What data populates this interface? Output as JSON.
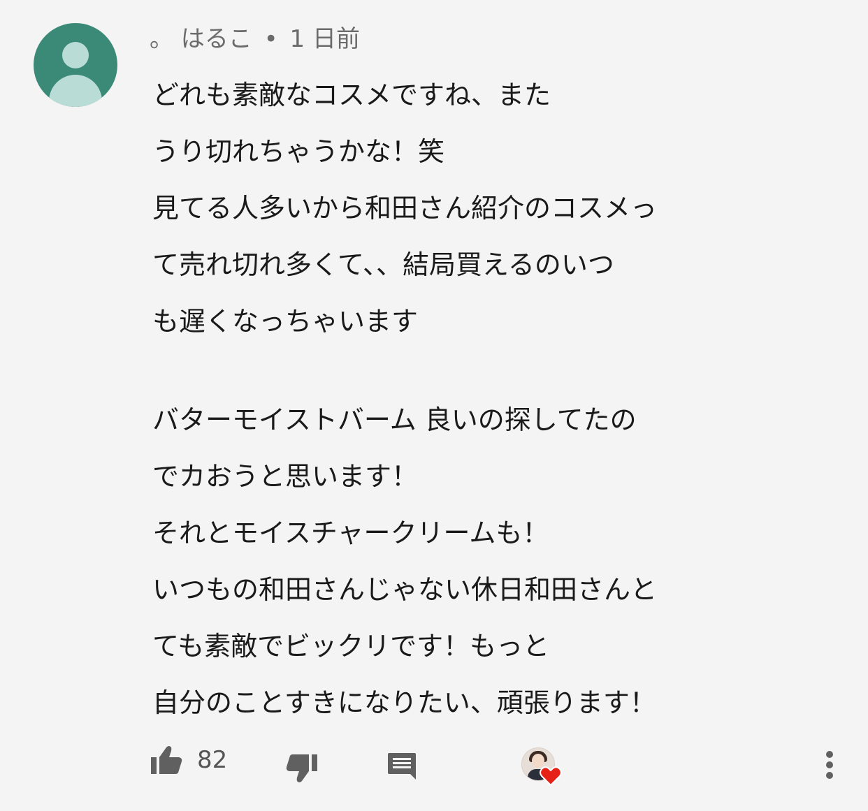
{
  "comment": {
    "author": "。 はるこ",
    "separator": "•",
    "time": "1 日前",
    "body_lines_1": [
      "どれも素敵なコスメですね、また",
      "うり切れちゃうかな！笑",
      "見てる人多いから和田さん紹介のコスメっ",
      "て売れ切れ多くて、、結局買えるのいつ",
      "も遅くなっちゃいます"
    ],
    "body_lines_2": [
      "バターモイストバーム 良いの探してたの",
      "でカおうと思います！",
      "それとモイスチャークリームも！",
      "いつもの和田さんじゃない休日和田さんと",
      "ても素敵でビックリです！もっと",
      "自分のことすきになりたい、頑張ります！"
    ]
  },
  "actions": {
    "like_count": "82"
  },
  "icons": {
    "avatar": "default-person-icon",
    "like": "thumbs-up-icon",
    "dislike": "thumbs-down-icon",
    "reply": "comment-icon",
    "creator_heart": "creator-heart-icon",
    "more": "more-vertical-icon"
  },
  "colors": {
    "background": "#f4f4f4",
    "avatar_bg": "#3b8a78",
    "avatar_fg": "#b9dcd6",
    "icon_gray": "#606060",
    "heart_red": "#e62117",
    "meta_text": "#6b6b6b"
  }
}
